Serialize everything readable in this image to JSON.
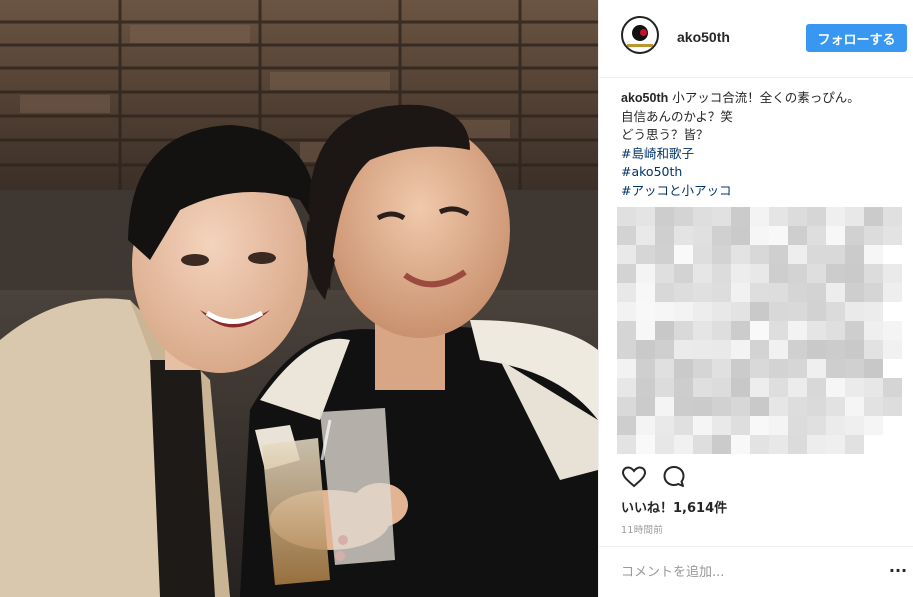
{
  "post": {
    "username": "ako50th",
    "follow_label": "フォローする"
  },
  "caption": {
    "username": "ako50th",
    "line1": "小アッコ合流！全くの素っぴん。",
    "line2": "自信あんのかよ？笑",
    "line3": "どう思う？皆？",
    "hashtags": [
      "#島崎和歌子",
      "#ako50th",
      "#アッコと小アッコ"
    ]
  },
  "actions": {
    "like_icon": "heart-outline",
    "comment_icon": "speech-bubble-outline"
  },
  "likes_text": "いいね！1,614件",
  "timestamp": "11時間前",
  "comment": {
    "placeholder": "コメントを追加...",
    "more_label": "..."
  },
  "colors": {
    "accent": "#3897f0",
    "hashtag": "#003569",
    "muted": "#999999",
    "divider": "#efefef"
  }
}
